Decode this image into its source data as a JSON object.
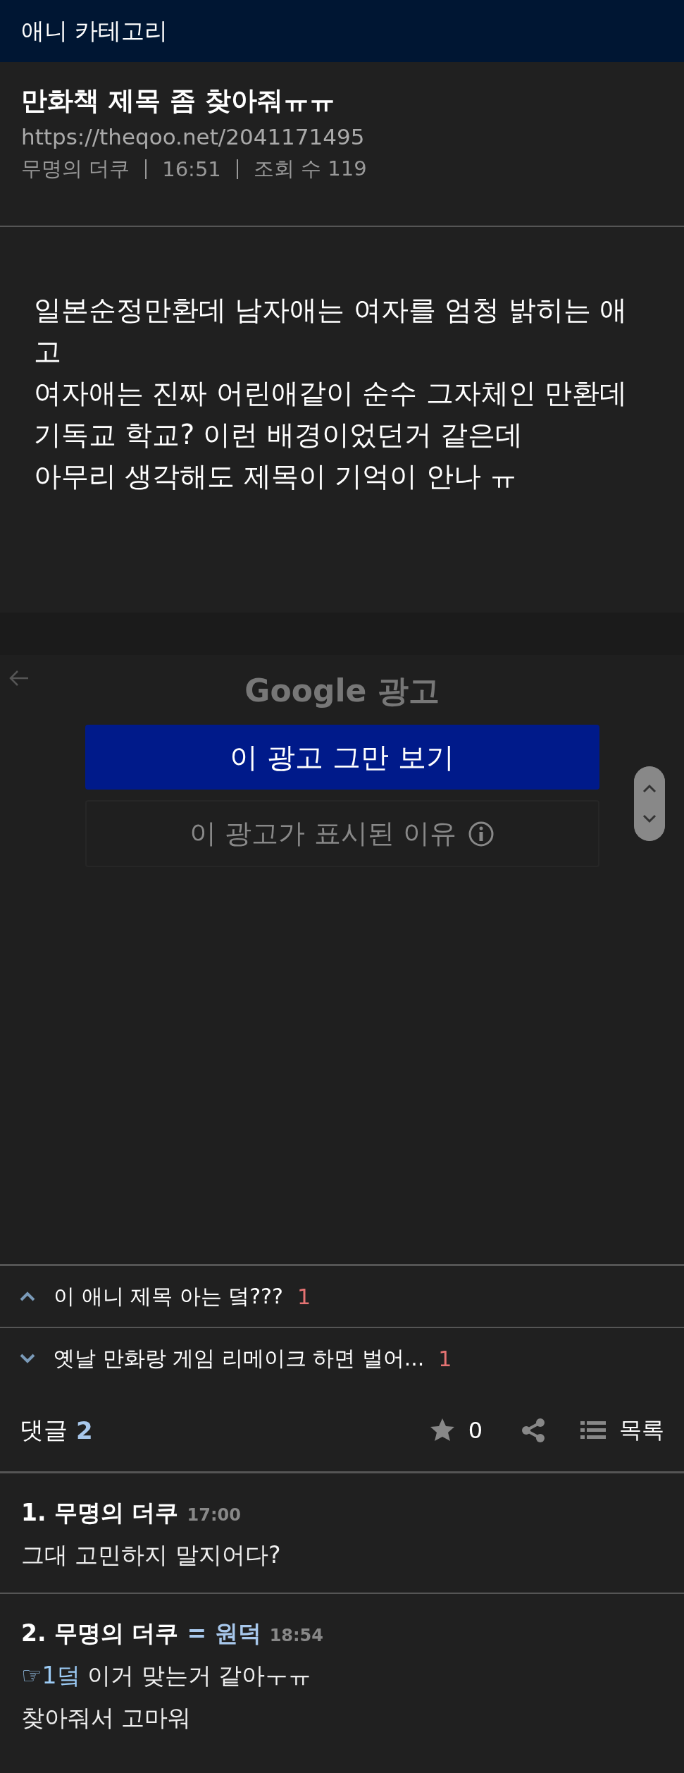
{
  "header": {
    "category": "애니 카테고리"
  },
  "post": {
    "title": "만화책 제목 좀 찾아줘ㅠㅠ",
    "url": "https://theqoo.net/2041171495",
    "author": "무명의 더쿠",
    "time": "16:51",
    "views": "조회 수 119",
    "body": [
      "일본순정만환데 남자애는 여자를 엄청 밝히는 애고",
      "여자애는 진짜 어린애같이 순수 그자체인 만환데",
      "기독교 학교? 이런 배경이었던거 같은데",
      "아무리 생각해도 제목이 기억이 안나 ㅠ"
    ]
  },
  "ad": {
    "label": "Google 광고",
    "stop_button": "이 광고 그만 보기",
    "why_button": "이 광고가 표시된 이유"
  },
  "nav_posts": [
    {
      "kind": "prev",
      "title": "이 애니 제목 아는 덬???",
      "comments": "1"
    },
    {
      "kind": "next",
      "title": "옛날 만화랑 게임 리메이크 하면 벌어...",
      "comments": "1"
    }
  ],
  "comment_bar": {
    "label": "댓글",
    "count": "2",
    "recommend_count": "0",
    "list_label": "목록"
  },
  "comments": [
    {
      "author": "1. 무명의 더쿠",
      "time": "17:00",
      "lines": [
        "그대 고민하지 말지어다?"
      ]
    },
    {
      "author": "2. 무명의 더쿠",
      "badge": "= 원덕",
      "time": "18:54",
      "mention": "☞1덬",
      "lines": [
        "이거 맞는거 같아ㅜㅠ",
        "찾아줘서 고마워"
      ]
    }
  ]
}
